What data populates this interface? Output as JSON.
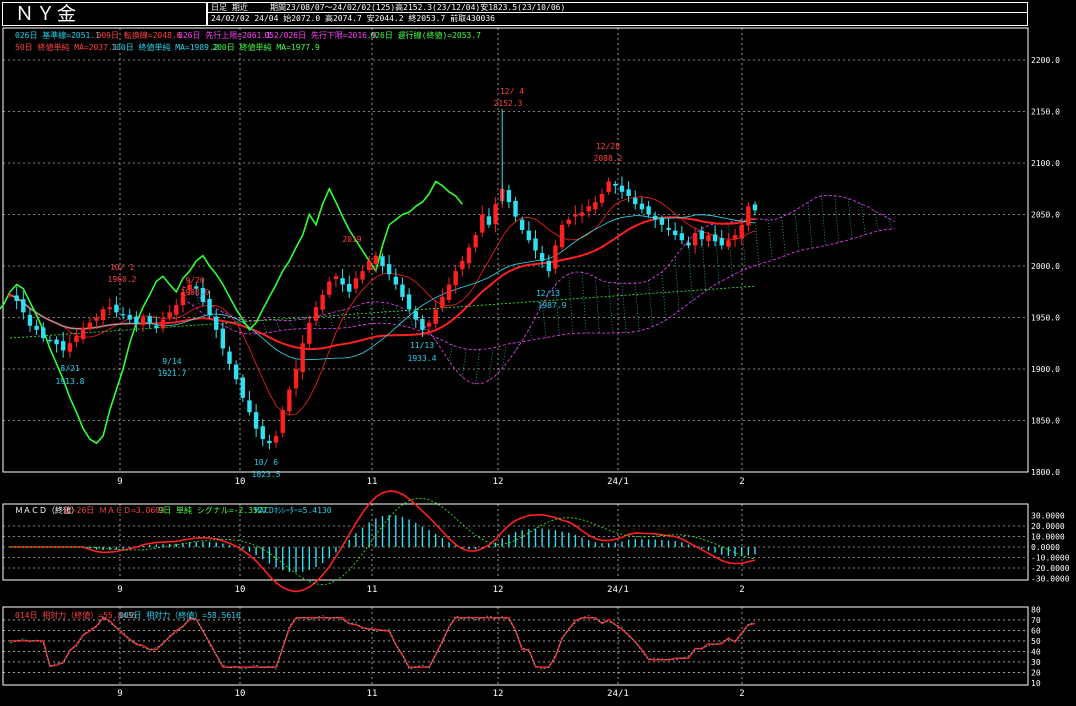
{
  "header": {
    "title": "ＮＹ金",
    "period_type": "日足 期近",
    "period_info": "期間23/08/07～24/02/02(125)高2152.3(23/12/04)安1823.5(23/10/06)",
    "latest_bar": "24/02/02 24/04 始2072.0 高2074.7 安2044.2 終2053.7 前取430036"
  },
  "legends": {
    "ichimoku": [
      {
        "text": "026日 基準線=2051.1",
        "color": "#22d3ee"
      },
      {
        "text": "009日 転換線=2048.6",
        "color": "#ff4040"
      },
      {
        "text": "026日 先行上限=2061.1",
        "color": "#ff40ff"
      },
      {
        "text": "052/026日 先行下限=2016.9",
        "color": "#ff40ff"
      },
      {
        "text": "026日 遅行線(終値)=2053.7",
        "color": "#40ff40"
      }
    ],
    "ma": [
      {
        "text": "50日 終値単純 MA=2037.1",
        "color": "#ff4040"
      },
      {
        "text": "100日 終値単純 MA=1989.2",
        "color": "#22d3ee"
      },
      {
        "text": "200日 終値単純 MA=1977.9",
        "color": "#40ff40"
      }
    ],
    "macd": [
      {
        "text": "ＭＡＣＤ（終値）",
        "color": "#ffffff"
      },
      {
        "text": "12-26日 ＭＡＣＤ=3.0603",
        "color": "#ff4040"
      },
      {
        "text": "9日 単純 シグナル=-2.3527",
        "color": "#40ff40"
      },
      {
        "text": "MACDｵｼﾚｰﾀｰ=5.4130",
        "color": "#22d3ee"
      }
    ],
    "rsi": [
      {
        "text": "014日 相対力（終値）=55.8435",
        "color": "#ff4040"
      },
      {
        "text": "009日 相対力（終値）=58.5616",
        "color": "#22d3ee"
      }
    ]
  },
  "axes": {
    "main_ticks": [
      "2200.0",
      "2150.0",
      "2100.0",
      "2050.0",
      "2000.0",
      "1950.0",
      "1900.0",
      "1850.0",
      "1800.0"
    ],
    "macd_ticks": [
      "30.0000",
      "20.0000",
      "10.0000",
      "0.0000",
      "-10.0000",
      "-20.0000",
      "-30.0000"
    ],
    "rsi_ticks": [
      "80",
      "70",
      "60",
      "50",
      "40",
      "30",
      "20",
      "10"
    ],
    "x_labels": [
      "9",
      "10",
      "11",
      "12",
      "24/1",
      "2"
    ]
  },
  "annotations": [
    {
      "text": "10/ 1",
      "color": "#ff4040"
    },
    {
      "text": "1960.2",
      "color": "#ff4040"
    },
    {
      "text": "9/20",
      "color": "#ff4040"
    },
    {
      "text": "1988.9",
      "color": "#ff4040"
    },
    {
      "text": "8/21",
      "color": "#22d3ee"
    },
    {
      "text": "1913.8",
      "color": "#22d3ee"
    },
    {
      "text": "9/14",
      "color": "#22d3ee"
    },
    {
      "text": "1921.7",
      "color": "#22d3ee"
    },
    {
      "text": "10/ 6",
      "color": "#22d3ee"
    },
    {
      "text": "1823.5",
      "color": "#22d3ee"
    },
    {
      "text": "2019",
      "color": "#ff4040"
    },
    {
      "text": "11/13",
      "color": "#22d3ee"
    },
    {
      "text": "1933.4",
      "color": "#22d3ee"
    },
    {
      "text": "12/ 4",
      "color": "#ff4040"
    },
    {
      "text": "2152.3",
      "color": "#ff4040"
    },
    {
      "text": "12/13",
      "color": "#22d3ee"
    },
    {
      "text": "1987.9",
      "color": "#22d3ee"
    },
    {
      "text": "12/28",
      "color": "#ff4040"
    },
    {
      "text": "2088.2",
      "color": "#ff4040"
    }
  ],
  "chart_data": [
    {
      "type": "candlestick",
      "title": "ＮＹ金",
      "ylim": [
        1800,
        2200
      ],
      "x_labels": [
        "9",
        "10",
        "11",
        "12",
        "24/1",
        "2"
      ],
      "close": [
        1972,
        1966,
        1955,
        1942,
        1938,
        1930,
        1928,
        1924,
        1918,
        1925,
        1932,
        1940,
        1945,
        1950,
        1958,
        1960,
        1955,
        1952,
        1948,
        1944,
        1950,
        1945,
        1940,
        1948,
        1955,
        1962,
        1975,
        1982,
        1978,
        1965,
        1952,
        1938,
        1920,
        1905,
        1890,
        1872,
        1858,
        1842,
        1832,
        1828,
        1835,
        1860,
        1880,
        1900,
        1925,
        1945,
        1960,
        1972,
        1985,
        1990,
        1982,
        1975,
        1988,
        1995,
        2005,
        2010,
        2000,
        1992,
        1982,
        1970,
        1958,
        1948,
        1938,
        1945,
        1958,
        1970,
        1982,
        1995,
        2005,
        2018,
        2030,
        2050,
        2040,
        2060,
        2075,
        2062,
        2048,
        2035,
        2025,
        2015,
        2005,
        1995,
        2020,
        2040,
        2045,
        2050,
        2052,
        2058,
        2062,
        2070,
        2082,
        2078,
        2072,
        2068,
        2060,
        2055,
        2050,
        2045,
        2040,
        2035,
        2030,
        2025,
        2020,
        2032,
        2026,
        2030,
        2024,
        2020,
        2025,
        2030,
        2040,
        2058,
        2054
      ],
      "high": 2152.3,
      "low": 1823.5,
      "lines": [
        "基準線",
        "転換線",
        "先行上限",
        "先行下限",
        "遅行線",
        "MA50",
        "MA100",
        "MA200"
      ]
    },
    {
      "type": "bar",
      "title": "ＭＡＣＤ（終値）",
      "ylim": [
        -30,
        30
      ],
      "series": [
        {
          "name": "MACDｵｼﾚｰﾀｰ",
          "last": 5.413
        },
        {
          "name": "12-26日 ＭＡＣＤ",
          "last": 3.0603
        },
        {
          "name": "9日 単純 シグナル",
          "last": -2.3527
        }
      ]
    },
    {
      "type": "line",
      "ylim": [
        10,
        80
      ],
      "series": [
        {
          "name": "014日 相対力（終値）",
          "last": 55.8435
        },
        {
          "name": "009日 相対力（終値）",
          "last": 58.5616
        }
      ]
    }
  ],
  "colors": {
    "grid": "#ffffff",
    "up": "#ff2020",
    "down": "#30e0f0",
    "ma": "#ff2020",
    "chikou": "#30ff30",
    "kumo": "#ff40ff"
  }
}
